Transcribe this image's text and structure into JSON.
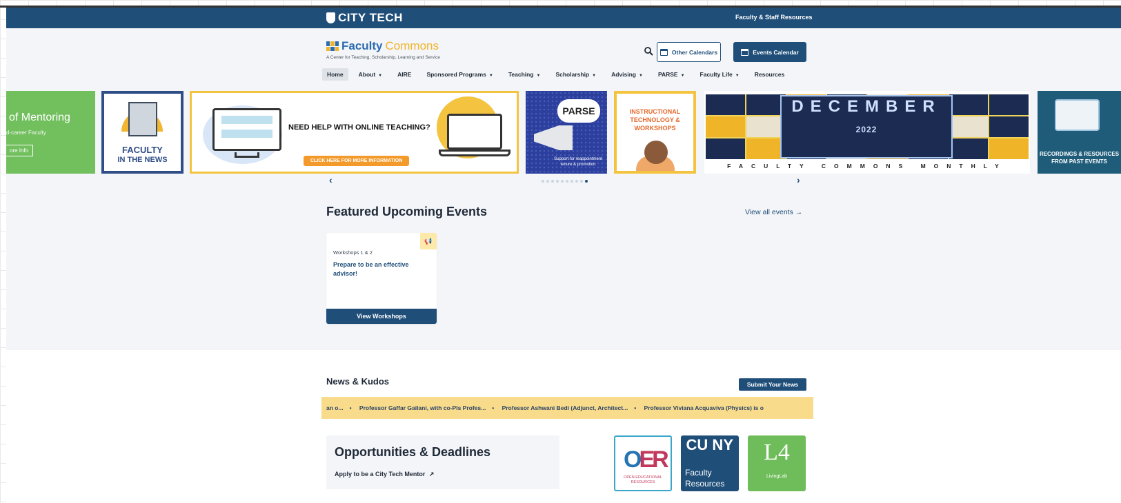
{
  "utility": {
    "logo": "CITY TECH",
    "link": "Faculty & Staff Resources"
  },
  "brand": {
    "word1": "Faculty",
    "word2": "Commons",
    "tagline": "A Center for Teaching, Scholarship, Learning and Service"
  },
  "header": {
    "other_calendars": "Other Calendars",
    "events_calendar": "Events Calendar"
  },
  "nav": [
    {
      "label": "Home",
      "caret": false
    },
    {
      "label": "About",
      "caret": true
    },
    {
      "label": "AIRE",
      "caret": false
    },
    {
      "label": "Sponsored Programs",
      "caret": true
    },
    {
      "label": "Teaching",
      "caret": true
    },
    {
      "label": "Scholarship",
      "caret": true
    },
    {
      "label": "Advising",
      "caret": true
    },
    {
      "label": "PARSE",
      "caret": true
    },
    {
      "label": "Faculty Life",
      "caret": true
    },
    {
      "label": "Resources",
      "caret": false
    }
  ],
  "carousel": {
    "s1": {
      "title": "of Mentoring",
      "sub": "d-career Faculty",
      "more": "ore Info"
    },
    "s2": {
      "line1": "FACULTY",
      "line2": "IN THE NEWS"
    },
    "s3": {
      "question": "NEED HELP WITH ONLINE TEACHING?",
      "cta": "CLICK HERE FOR MORE INFORMATION"
    },
    "s4": {
      "bubble": "PARSE",
      "caption": "Support for reappointment tenure & promotion"
    },
    "s5": {
      "title": "INSTRUCTIONAL TECHNOLOGY & WORKSHOPS"
    },
    "s6": {
      "big": "DECEMBER",
      "year": "2022",
      "footer": "FACULTY COMMONS MONTHLY"
    },
    "s7": {
      "title": "RECORDINGS & RESOURCES FROM PAST EVENTS"
    },
    "prev": "‹",
    "next": "›",
    "dot_count": 10,
    "active_dot": 9
  },
  "events": {
    "title": "Featured Upcoming Events",
    "view_all": "View all events →",
    "card": {
      "badge": "📢",
      "sub": "Workshops 1 & 2",
      "name": "Prepare to be an effective advisor!",
      "button": "View Workshops"
    }
  },
  "news": {
    "title": "News & Kudos",
    "submit": "Submit Your News",
    "ticker": [
      "an o...",
      "Professor Gaffar Gailani, with co-PIs Profes...",
      "Professor Ashwani Bedi (Adjunct, Architect...",
      "Professor Viviana Acquaviva (Physics) is o"
    ]
  },
  "opportunities": {
    "title": "Opportunities & Deadlines",
    "link": "Apply to be a City Tech Mentor"
  },
  "tiles": {
    "oer": {
      "logo_a": "O",
      "logo_b": "ER",
      "caption": "OPEN EDUCATIONAL RESOURCES"
    },
    "cuny": {
      "logo": "CU NY",
      "label": "Faculty Resources"
    },
    "l4": {
      "logo": "L4",
      "label": "LivingLab"
    }
  },
  "colors": {
    "navy": "#1f4e79",
    "gold": "#f0b429",
    "ticker": "#f8dc8c",
    "green": "#72bf5e"
  }
}
